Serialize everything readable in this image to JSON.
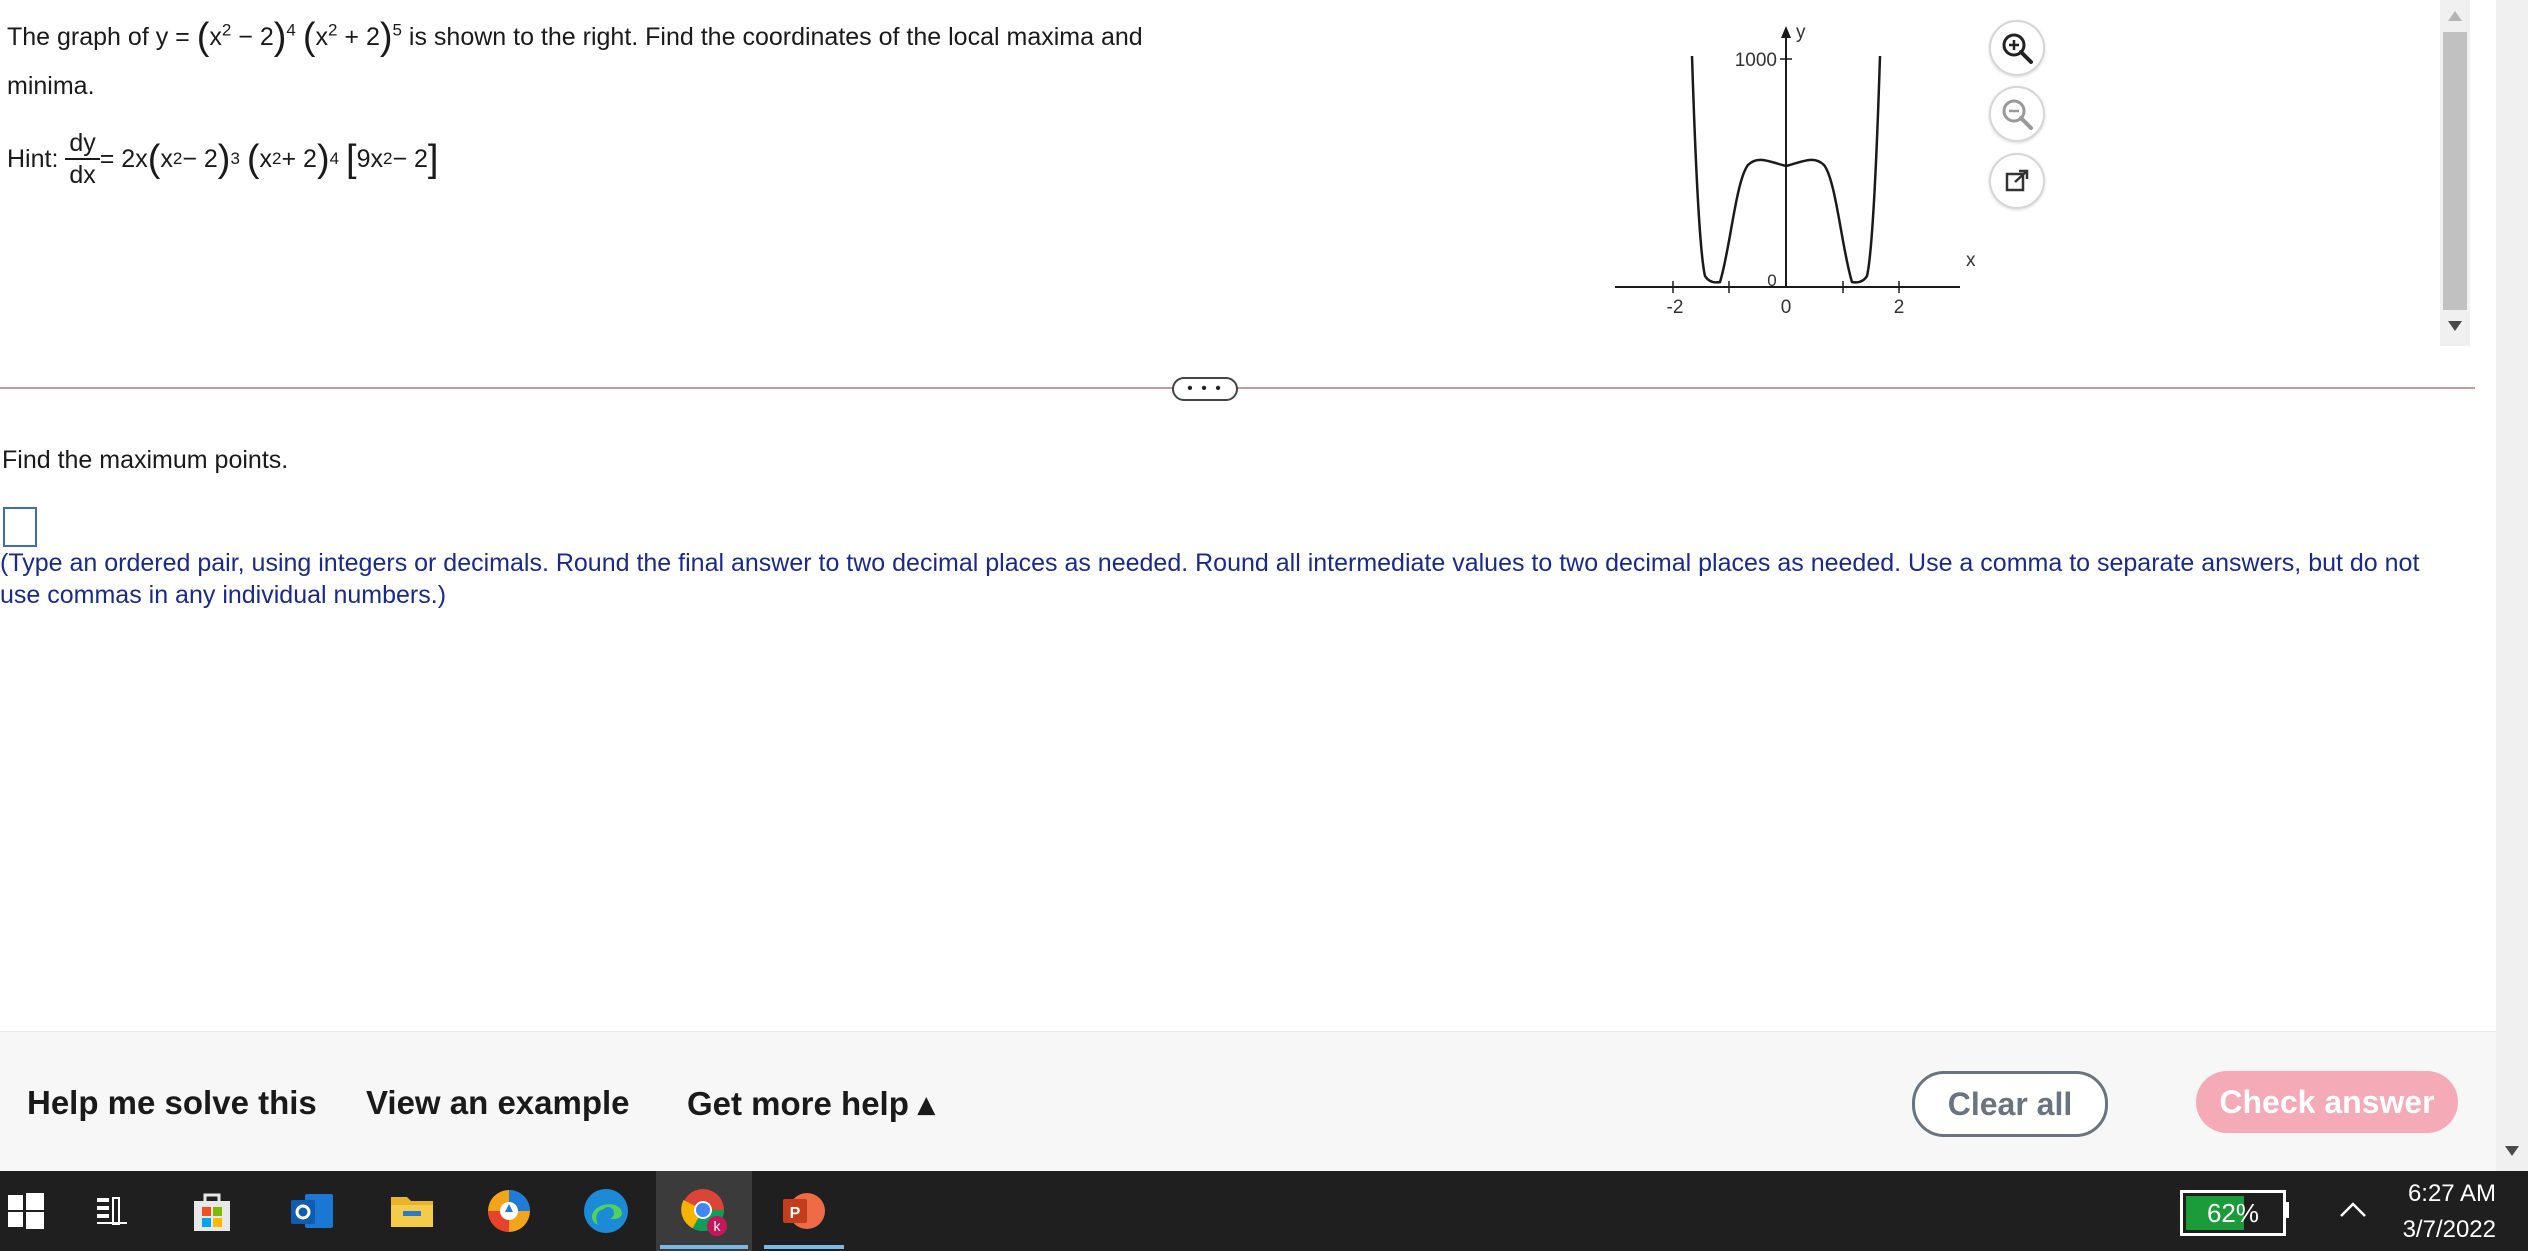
{
  "question": {
    "intro": "The graph of y =",
    "base1": "x",
    "exp_inner1": "2",
    "const1": " − 2",
    "power1": "4",
    "base2": "x",
    "exp_inner2": "2",
    "const2": " + 2",
    "power2": "5",
    "after": " is shown to the right. Find the coordinates of the local maxima and",
    "line2": "minima."
  },
  "hint": {
    "label": "Hint:",
    "num": "dy",
    "den": "dx",
    "eq": " = 2x",
    "b1": "x",
    "e1": "2",
    "c1": " − 2",
    "p1": "3",
    "b2": "x",
    "e2": "2",
    "c2": " + 2",
    "p2": "4",
    "bracket": "9x",
    "be": "2",
    "bc": " − 2"
  },
  "graph": {
    "y_label": "y",
    "x_label": "x",
    "y_tick": "1000",
    "origin_label": "0",
    "x_ticks": [
      "-2",
      "0",
      "2"
    ]
  },
  "tools": {
    "zoom_in": "zoom-in",
    "zoom_out": "zoom-out",
    "popout": "open-external"
  },
  "handle_label": "• • •",
  "prompt": "Find the maximum points.",
  "instructions": "(Type an ordered pair, using integers or decimals. Round the final answer to two decimal places as needed. Round all intermediate values to two decimal places as needed. Use a comma to separate answers, but do not use commas in any individual numbers.)",
  "footer": {
    "help": "Help me solve this",
    "example": "View an example",
    "more": "Get more help ▴",
    "clear": "Clear all",
    "check": "Check answer"
  },
  "taskbar": {
    "battery": "62%",
    "battery_level": 0.62,
    "time": "6:27 AM",
    "date": "3/7/2022"
  },
  "colors": {
    "accent_blue": "#1a2a8c",
    "check_button": "#f5aab8",
    "divider": "#c49a9a"
  }
}
